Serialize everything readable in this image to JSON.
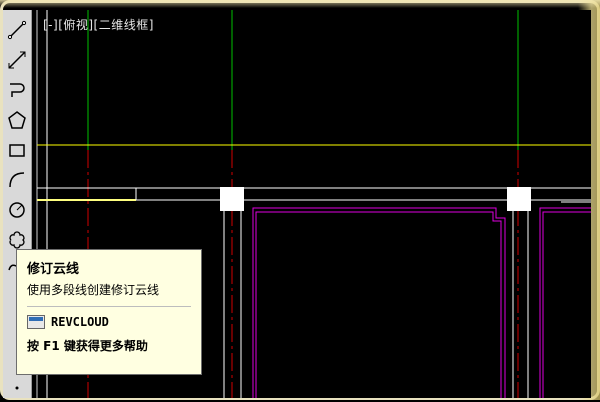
{
  "viewport": {
    "label": "[-][俯视][二维线框]"
  },
  "toolbar": {
    "tools": [
      {
        "name": "line-icon"
      },
      {
        "name": "construction-line-icon"
      },
      {
        "name": "polyline-icon"
      },
      {
        "name": "polygon-icon"
      },
      {
        "name": "rectangle-icon"
      },
      {
        "name": "arc-icon"
      },
      {
        "name": "circle-icon"
      },
      {
        "name": "revcloud-icon"
      },
      {
        "name": "spline-icon"
      }
    ]
  },
  "tooltip": {
    "title": "修订云线",
    "description": "使用多段线创建修订云线",
    "command": "REVCLOUD",
    "help": "按 F1 键获得更多帮助"
  },
  "colors": {
    "background": "#000000",
    "tooltip_bg": "#ffffe1",
    "grid_green": "#00c000",
    "grid_red": "#d00000",
    "line_yellow": "#ffff00",
    "line_cyan": "#00c0c0",
    "line_magenta": "#e000e0",
    "line_white": "#ffffff"
  }
}
